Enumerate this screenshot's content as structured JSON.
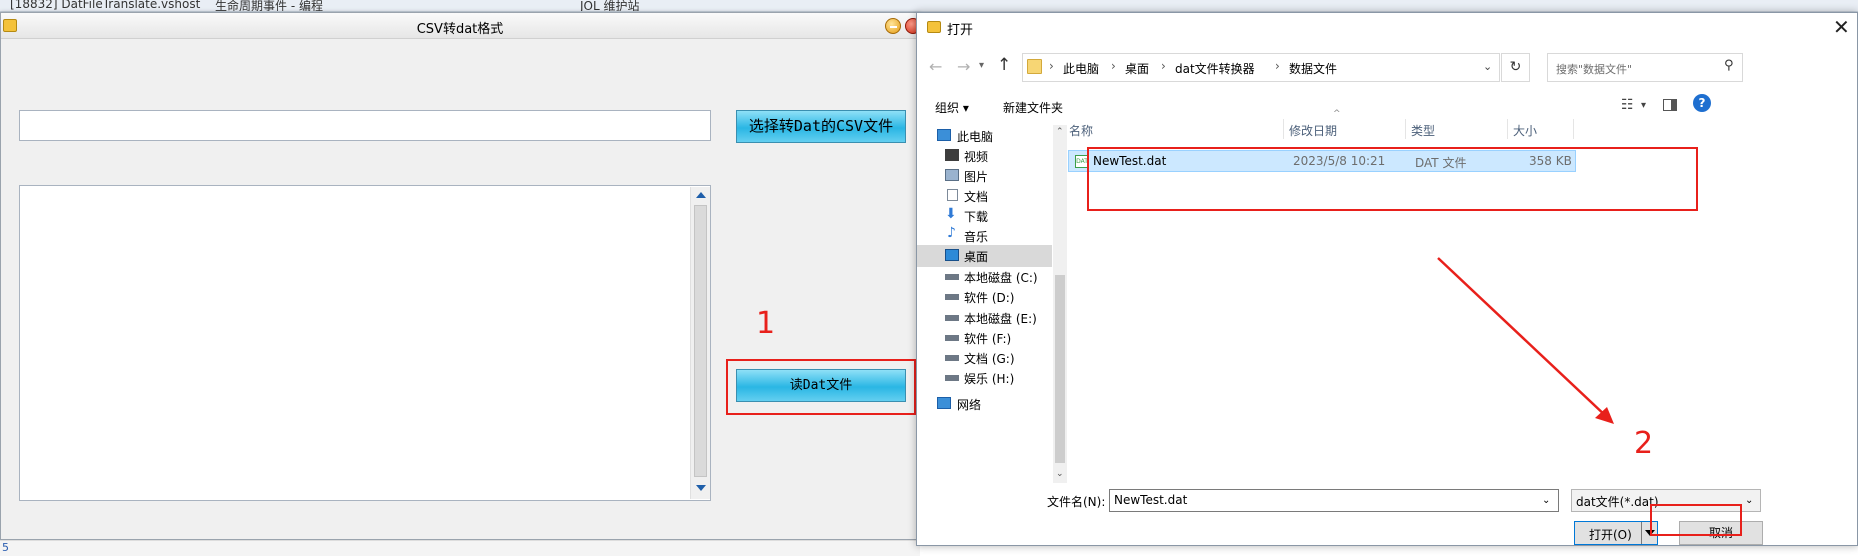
{
  "background_tabs": [
    "[18832] DatFileTranslate.vshost",
    "生命周期事件 - 编程",
    "JOL 维护站"
  ],
  "app_window": {
    "title": "CSV转dat格式",
    "select_button": "选择转Dat的CSV文件",
    "read_button": "读Dat文件",
    "path_value": "",
    "log_value": ""
  },
  "annotations": {
    "step1": "1",
    "step2": "2",
    "color": "#e8201b"
  },
  "status_strip": "5",
  "open_dialog": {
    "title": "打开",
    "breadcrumb": [
      "此电脑",
      "桌面",
      "dat文件转换器",
      "数据文件"
    ],
    "search_placeholder": "搜索\"数据文件\"",
    "toolbar": {
      "organize": "组织 ▾",
      "new_folder": "新建文件夹"
    },
    "nav_tree": [
      {
        "label": "此电脑",
        "icon": "computer-icon"
      },
      {
        "label": "视频",
        "icon": "video-icon"
      },
      {
        "label": "图片",
        "icon": "picture-icon"
      },
      {
        "label": "文档",
        "icon": "document-icon"
      },
      {
        "label": "下载",
        "icon": "download-icon"
      },
      {
        "label": "音乐",
        "icon": "music-icon"
      },
      {
        "label": "桌面",
        "icon": "desktop-icon"
      },
      {
        "label": "本地磁盘 (C:)",
        "icon": "drive-icon"
      },
      {
        "label": "软件 (D:)",
        "icon": "drive-icon"
      },
      {
        "label": "本地磁盘 (E:)",
        "icon": "drive-icon"
      },
      {
        "label": "软件 (F:)",
        "icon": "drive-icon"
      },
      {
        "label": "文档 (G:)",
        "icon": "drive-icon"
      },
      {
        "label": "娱乐 (H:)",
        "icon": "drive-icon"
      },
      {
        "label": "网络",
        "icon": "network-icon"
      }
    ],
    "columns": [
      "名称",
      "修改日期",
      "类型",
      "大小"
    ],
    "files": [
      {
        "name": "NewTest.dat",
        "modified": "2023/5/8 10:21",
        "type": "DAT 文件",
        "size": "358 KB"
      }
    ],
    "file_name_label": "文件名(N):",
    "file_name_value": "NewTest.dat",
    "filter_value": "dat文件(*.dat)",
    "open_button": "打开(O)",
    "cancel_button": "取消"
  }
}
